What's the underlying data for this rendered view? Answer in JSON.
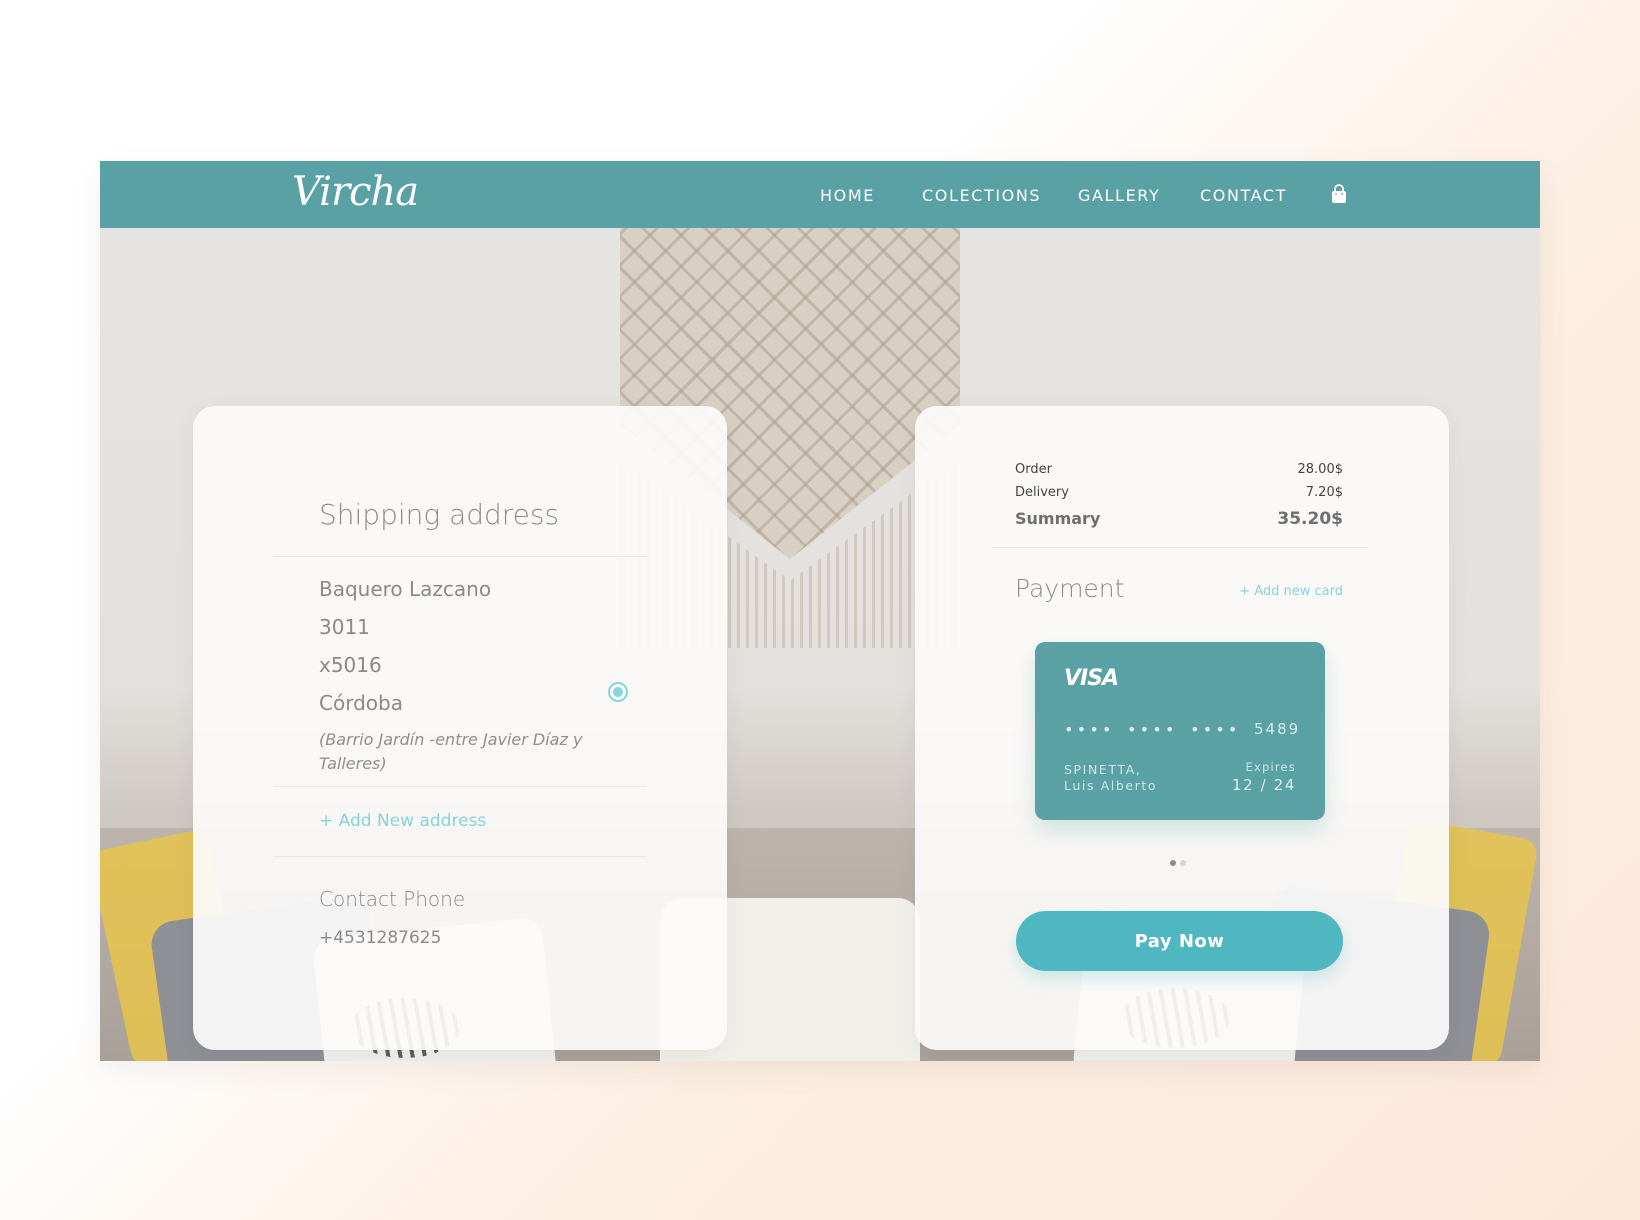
{
  "brand": {
    "logo": "Vircha"
  },
  "nav": {
    "links": [
      "HOME",
      "COLECTIONS",
      "GALLERY",
      "CONTACT"
    ]
  },
  "shipping": {
    "title": "Shipping address",
    "lines": [
      "Baquero Lazcano",
      "3011",
      "x5016",
      "Córdoba"
    ],
    "note": "(Barrio Jardín -entre Javier Díaz y Talleres)",
    "add_address": "+ Add New address",
    "phone_title": "Contact Phone",
    "phone": "+4531287625"
  },
  "summary": {
    "order_label": "Order",
    "order_value": "28.00$",
    "delivery_label": "Delivery",
    "delivery_value": "7.20$",
    "total_label": "Summary",
    "total_value": "35.20$"
  },
  "payment": {
    "title": "Payment",
    "add_card": "+ Add new card",
    "card": {
      "brand": "VISA",
      "masked_groups": [
        "••••",
        "••••",
        "••••"
      ],
      "last4": "5489",
      "holder_line1": "SPINETTA,",
      "holder_line2": "Luis Alberto",
      "expires_label": "Expires",
      "expires": "12 / 24"
    },
    "pay_label": "Pay Now"
  },
  "colors": {
    "primary": "#5aa1a6",
    "accent": "#4fb7bf",
    "link": "#86d3db"
  },
  "icons": {
    "cart": "shopping-bag-icon",
    "radio": "radio-selected-icon"
  }
}
